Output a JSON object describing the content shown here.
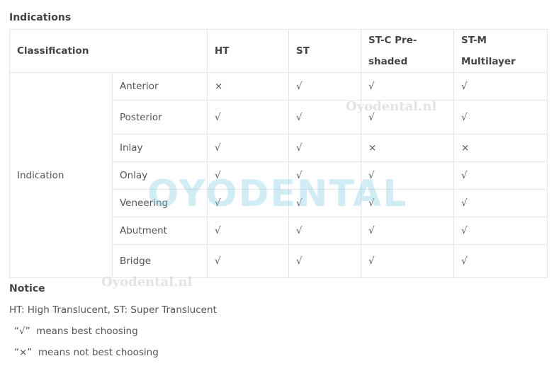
{
  "title": "Indications",
  "headers": [
    "Classification",
    "HT",
    "ST",
    "ST-C Pre-shaded",
    "ST-M Multilayer"
  ],
  "group_label": "Indication",
  "rows": [
    {
      "label": "Anterior",
      "values": [
        "×",
        "√",
        "√",
        "√"
      ]
    },
    {
      "label": "Posterior",
      "values": [
        "√",
        "√",
        "√",
        "√"
      ]
    },
    {
      "label": "Inlay",
      "values": [
        "√",
        "√",
        "×",
        "×"
      ]
    },
    {
      "label": "Onlay",
      "values": [
        "√",
        "√",
        "√",
        "√"
      ]
    },
    {
      "label": "Veneering",
      "values": [
        "√",
        "√",
        "√",
        "√"
      ]
    },
    {
      "label": "Abutment",
      "values": [
        "√",
        "√",
        "√",
        "√"
      ]
    },
    {
      "label": "Bridge",
      "values": [
        "√",
        "√",
        "√",
        "√"
      ]
    }
  ],
  "notice": {
    "title": "Notice",
    "lines": [
      "HT: High Translucent, ST: Super Translucent",
      "“√”  means best choosing",
      "“×”  means not best choosing"
    ]
  },
  "watermark": {
    "logo": "OYODENTAL",
    "small": "Oyodental.nl"
  }
}
